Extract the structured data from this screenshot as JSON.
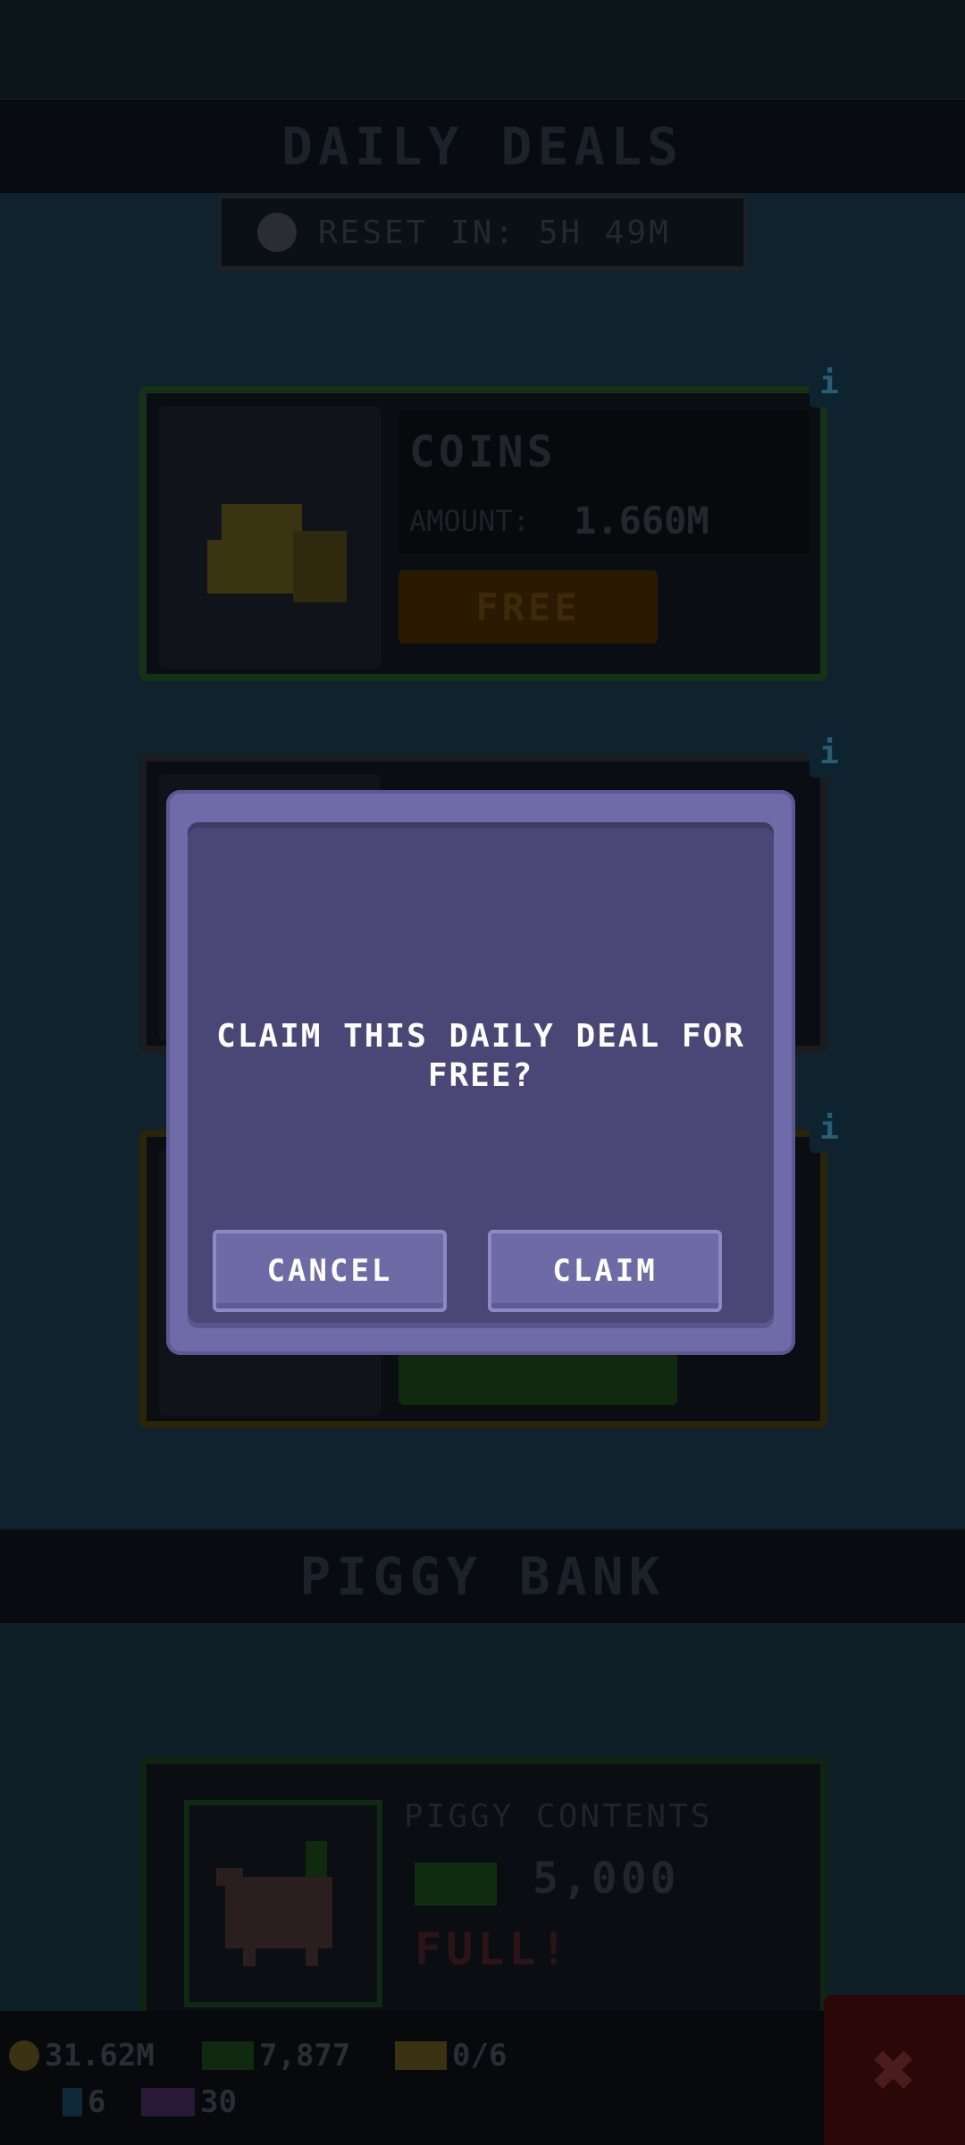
{
  "daily_deals": {
    "title": "DAILY DEALS",
    "reset_label": "RESET IN: 5H 49M"
  },
  "deal_card": {
    "title": "COINS",
    "amount_label": "AMOUNT:",
    "amount_value": "1.660M",
    "button_label": "FREE"
  },
  "dialog": {
    "message": "CLAIM THIS DAILY DEAL FOR FREE?",
    "cancel_label": "CANCEL",
    "claim_label": "CLAIM"
  },
  "piggy_bank": {
    "title": "PIGGY BANK",
    "contents_label": "PIGGY CONTENTS",
    "contents_value": "5,000",
    "status": "FULL!"
  },
  "status_bar": {
    "coins": "31.62M",
    "cash": "7,877",
    "tickets": "0/6",
    "gems": "6",
    "tv_count": "30"
  },
  "info_badge_text": "i",
  "close_symbol": "✖"
}
